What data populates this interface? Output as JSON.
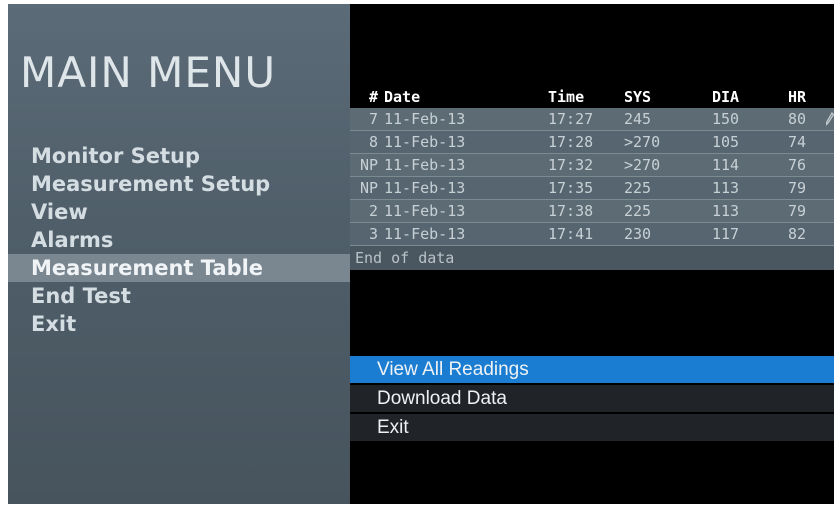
{
  "sidebar": {
    "title": "MAIN MENU",
    "items": [
      {
        "label": "Monitor Setup"
      },
      {
        "label": "Measurement Setup"
      },
      {
        "label": "View"
      },
      {
        "label": "Alarms"
      },
      {
        "label": "Measurement Table",
        "selected": true
      },
      {
        "label": "End Test"
      },
      {
        "label": "Exit"
      }
    ]
  },
  "table": {
    "headers": [
      "#",
      "Date",
      "Time",
      "SYS",
      "DIA",
      "HR"
    ],
    "rows": [
      [
        "7",
        "11-Feb-13",
        "17:27",
        "245",
        "150",
        "80"
      ],
      [
        "8",
        "11-Feb-13",
        "17:28",
        ">270",
        "105",
        "74"
      ],
      [
        "NP",
        "11-Feb-13",
        "17:32",
        ">270",
        "114",
        "76"
      ],
      [
        "NP",
        "11-Feb-13",
        "17:35",
        "225",
        "113",
        "79"
      ],
      [
        "2",
        "11-Feb-13",
        "17:38",
        "225",
        "113",
        "79"
      ],
      [
        "3",
        "11-Feb-13",
        "17:41",
        "230",
        "117",
        "82"
      ]
    ],
    "end_text": "End of data"
  },
  "actions": {
    "items": [
      {
        "label": "View All Readings",
        "selected": true
      },
      {
        "label": "Download Data"
      },
      {
        "label": "Exit"
      }
    ]
  },
  "colors": {
    "selected_action": "#1a7dd1",
    "sidebar_bg": "#55646f",
    "selected_menu": "#7a8790"
  },
  "icons": {
    "row_edit": "pencil-icon"
  }
}
